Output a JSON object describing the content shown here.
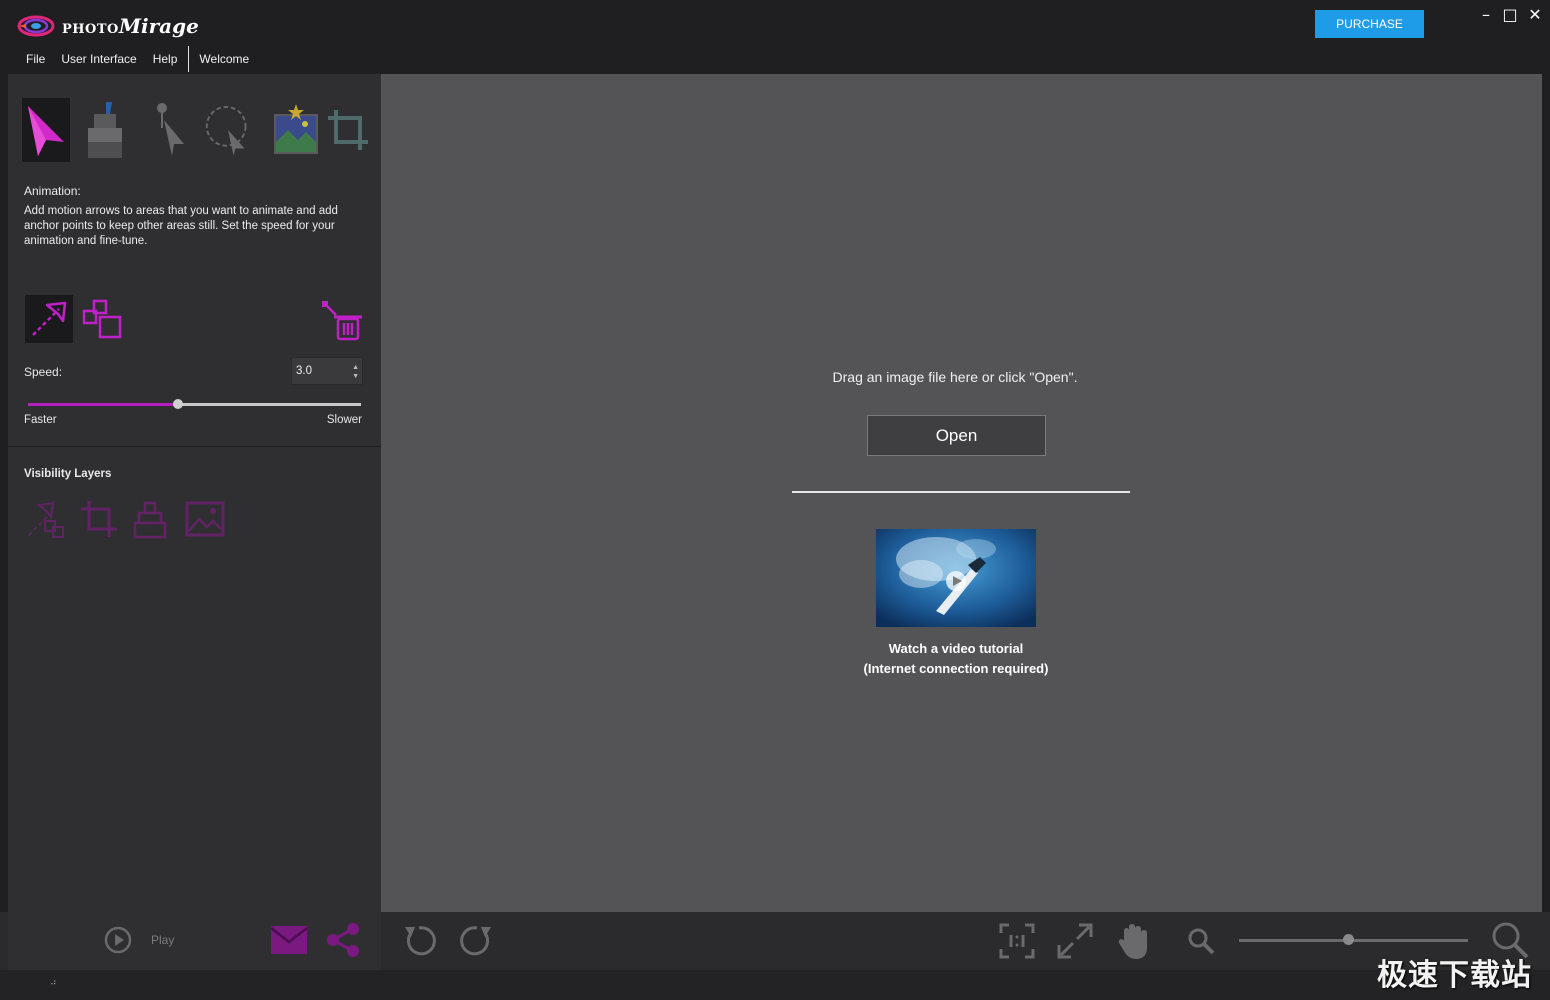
{
  "app": {
    "logo_small": "PHOTO",
    "logo_big": "Mirage"
  },
  "titlebar": {
    "purchase_label": "PURCHASE",
    "minimize_glyph": "–",
    "maximize_glyph": "□",
    "close_glyph": "✕"
  },
  "menu": {
    "items": [
      "File",
      "User Interface",
      "Help",
      "Welcome"
    ]
  },
  "tools": [
    {
      "icon": "animation-tool-icon",
      "selected": true
    },
    {
      "icon": "mask-tool-icon",
      "selected": false
    },
    {
      "icon": "anchor-selection-icon",
      "selected": false
    },
    {
      "icon": "lasso-selection-icon",
      "selected": false
    },
    {
      "icon": "image-icon",
      "selected": false
    },
    {
      "icon": "crop-icon",
      "selected": false
    }
  ],
  "panel": {
    "animation_title": "Animation:",
    "animation_desc": "Add motion arrows to areas that you want to animate and add anchor points to keep other areas still. Set the speed for your animation and fine-tune.",
    "speed_label": "Speed:",
    "speed_value": "3.0",
    "speed_fraction": 0.45,
    "faster_label": "Faster",
    "slower_label": "Slower",
    "visibility_title": "Visibility Layers"
  },
  "canvas": {
    "drag_text": "Drag an image file here or click \"Open\".",
    "open_label": "Open",
    "video_line1": "Watch a video tutorial",
    "video_line2": "(Internet connection required)"
  },
  "bottom": {
    "play_label": "Play",
    "zoom_fraction": 0.48
  },
  "watermark": "极速下载站",
  "colors": {
    "accent": "#b620c0",
    "purchase": "#1e9ce8",
    "canvas": "#545456",
    "panel": "#2f2f31"
  }
}
